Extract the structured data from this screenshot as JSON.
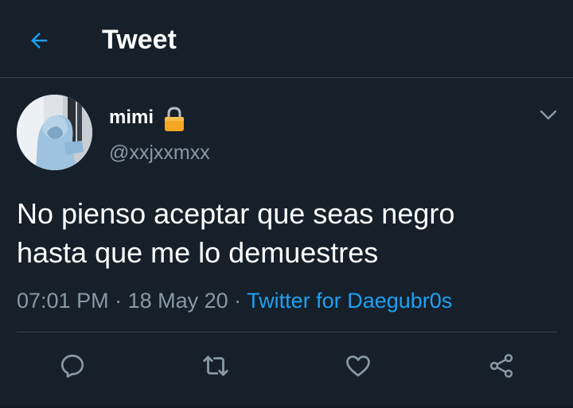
{
  "header": {
    "title": "Tweet",
    "back_icon": "arrow-left-icon"
  },
  "tweet": {
    "author": {
      "display_name": "mimi",
      "name_emoji": "lock-icon",
      "handle": "@xxjxxmxx"
    },
    "text_lines": [
      "No pienso aceptar que seas negro",
      "hasta que me lo demuestres"
    ],
    "time": "07:01 PM",
    "separator": " · ",
    "date": "18 May 20",
    "source": "Twitter for Daegubr0s"
  },
  "actions": [
    {
      "name": "reply",
      "icon": "reply-icon"
    },
    {
      "name": "retweet",
      "icon": "retweet-icon"
    },
    {
      "name": "like",
      "icon": "heart-icon"
    },
    {
      "name": "share",
      "icon": "share-icon"
    }
  ],
  "colors": {
    "background": "#15202b",
    "accent": "#1da1f2",
    "secondary_text": "#8899a6",
    "divider": "#38444d"
  }
}
